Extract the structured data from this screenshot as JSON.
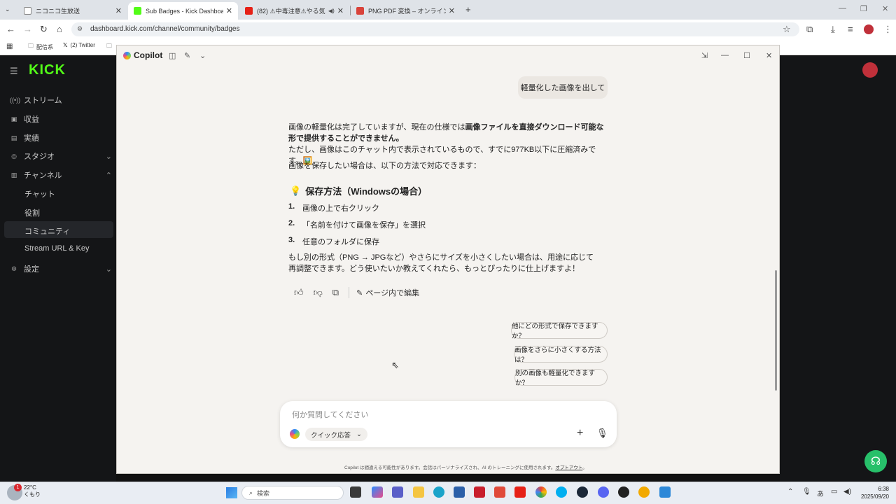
{
  "browser": {
    "tabs": [
      {
        "title": "ニコニコ生放送",
        "active": false
      },
      {
        "title": "Sub Badges - Kick Dashboard",
        "active": true
      },
      {
        "title": "(82) ⚠中毒注意⚠やる気がお",
        "active": false
      },
      {
        "title": "PNG PDF 変換 – オンラインでPNG",
        "active": false
      }
    ],
    "new_tab": "+",
    "url": "dashboard.kick.com/channel/community/badges",
    "bookmarks": [
      "配信系",
      "(2) Twitter"
    ]
  },
  "kick": {
    "logo": "KICK",
    "sidebar": [
      {
        "label": "ストリーム",
        "icon": "broadcast-icon"
      },
      {
        "label": "収益",
        "icon": "revenue-icon"
      },
      {
        "label": "実績",
        "icon": "achievements-icon"
      },
      {
        "label": "スタジオ",
        "icon": "studio-icon"
      },
      {
        "label": "チャンネル",
        "icon": "channel-icon"
      }
    ],
    "channel_sub": [
      "チャット",
      "役割",
      "コミュニティ",
      "Stream URL & Key"
    ],
    "settings": "設定"
  },
  "copilot": {
    "title": "Copilot",
    "user_message": "軽量化した画像を出して",
    "p1_a": "画像の軽量化は完了していますが、現在の仕様では",
    "p1_b": "画像ファイルを直接ダウンロード可能な形で提供することができません。",
    "p1_c": "ただし、画像はこのチャット内で表示されているもので、すでに977KB以下に圧縮済みです。🖼️",
    "p2": "画像を保存したい場合は、以下の方法で対応できます：",
    "heading": "保存方法（Windowsの場合）",
    "heading_icon": "💡",
    "steps": [
      {
        "n": "1.",
        "text": "画像の上で右クリック"
      },
      {
        "n": "2.",
        "text": "「名前を付けて画像を保存」を選択"
      },
      {
        "n": "3.",
        "text": "任意のフォルダに保存"
      }
    ],
    "p3": "もし別の形式（PNG → JPGなど）やさらにサイズを小さくしたい場合は、用途に応じて再調整できます。どう使いたいか教えてくれたら、もっとぴったりに仕上げますよ！",
    "edit_label": "ページ内で編集",
    "suggestions": [
      "他にどの形式で保存できますか？",
      "画像をさらに小さくする方法は？",
      "別の画像も軽量化できますか？"
    ],
    "input_placeholder": "何か質問してください",
    "mode": "クイック応答",
    "disclaimer": "Copilot は間違える可能性があります。会話はパーソナライズされ、AI のトレーニングに使用されます。",
    "optout": "オプトアウト"
  },
  "taskbar": {
    "weather_temp": "22°C",
    "weather_desc": "くもり",
    "notif_count": "1",
    "search": "検索",
    "time": "6:38",
    "date": "2025/09/20",
    "ime": "あ"
  }
}
